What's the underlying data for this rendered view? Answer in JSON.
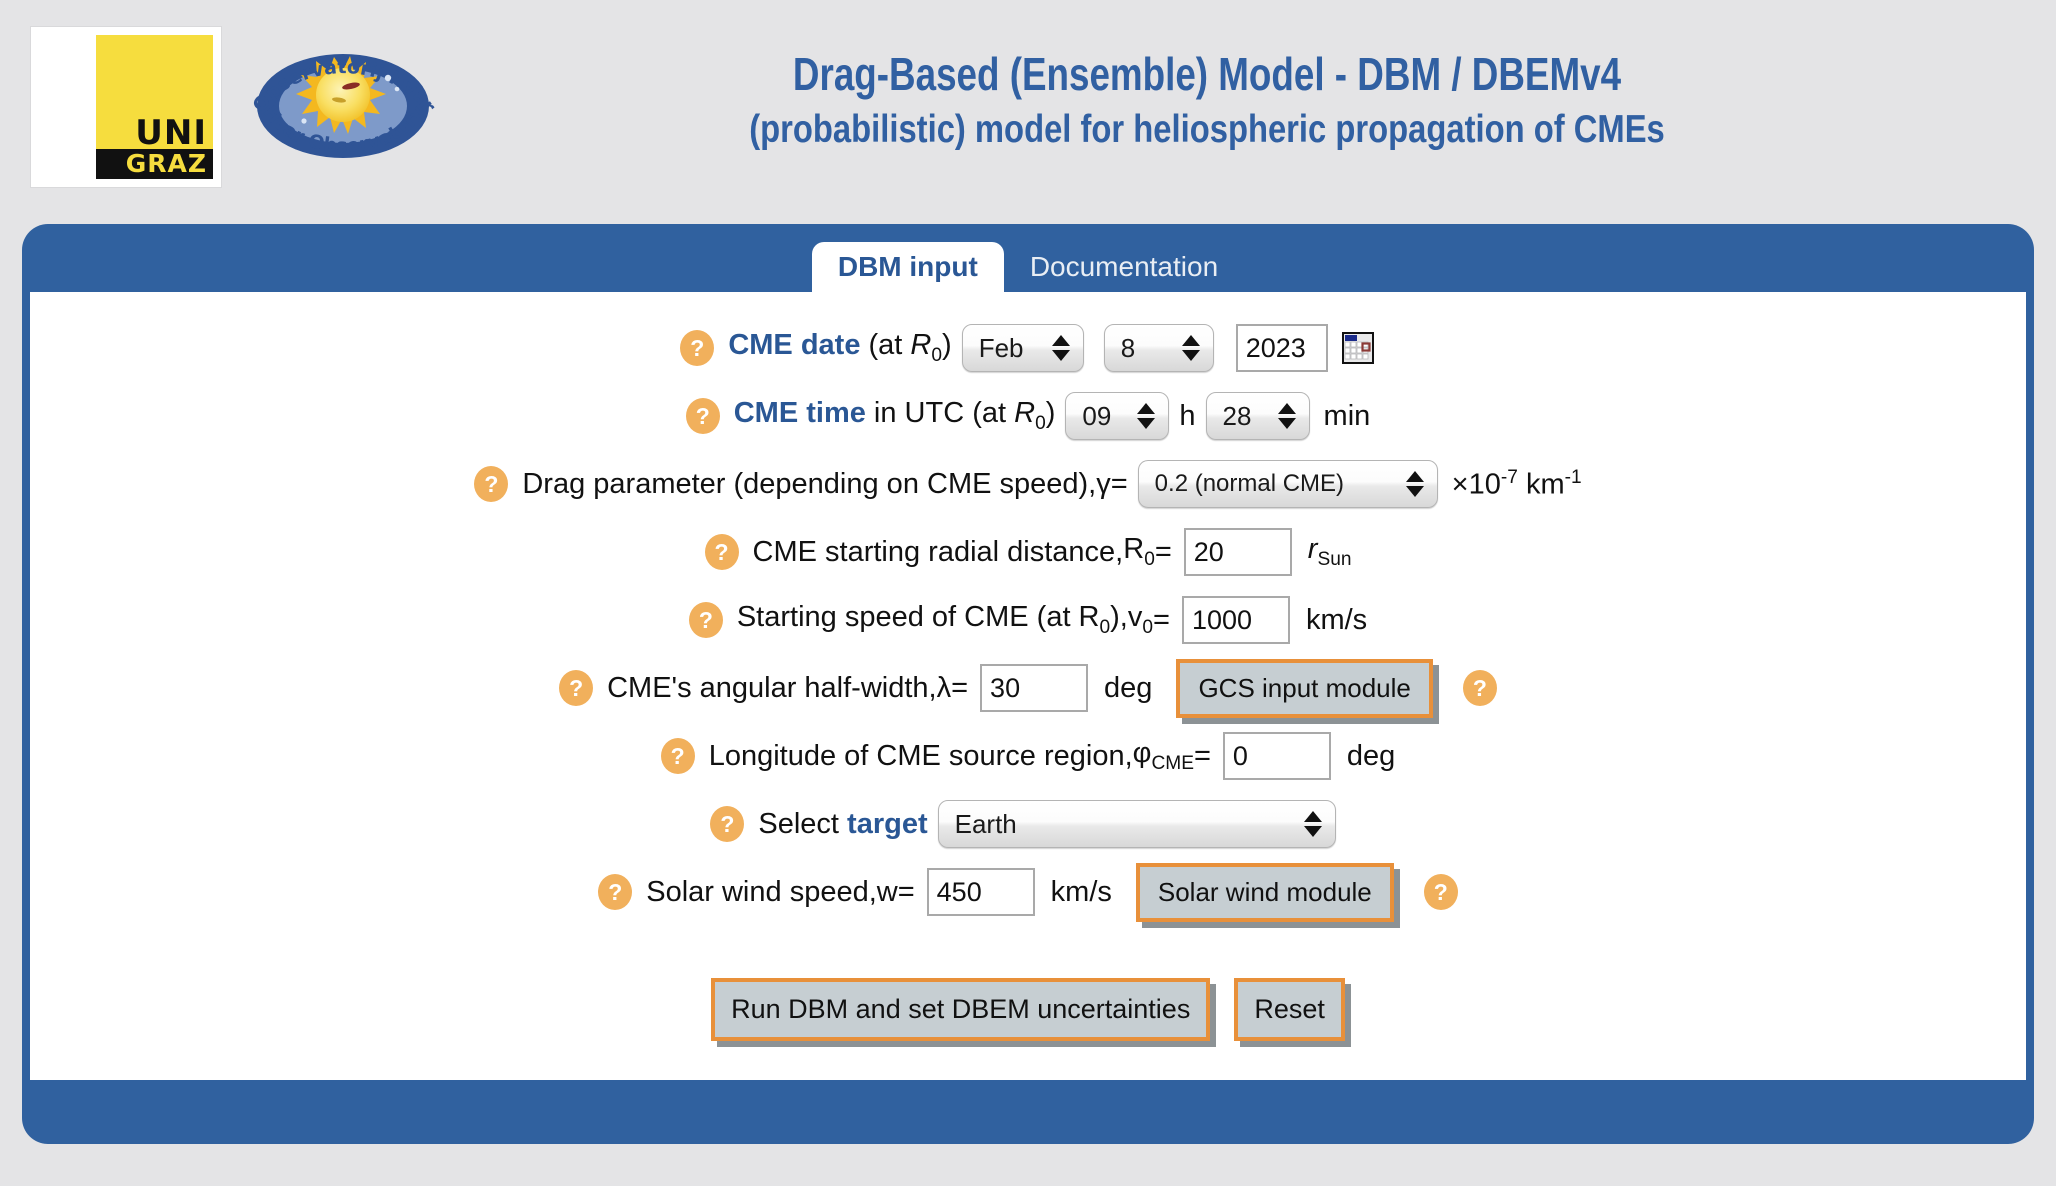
{
  "header": {
    "logo_unigraz": {
      "line1": "UNI",
      "line2": "GRAZ",
      "icon": "unigraz-logo"
    },
    "logo_hvar": {
      "top_text": "Opservatorij Hvar",
      "bottom_text": "Hvar Observatory",
      "icon": "hvar-observatory-logo"
    },
    "title_main": "Drag-Based (Ensemble) Model - DBM / DBEMv4",
    "title_sub": "(probabilistic) model for heliospheric propagation of CMEs"
  },
  "tabs": [
    {
      "label": "DBM input",
      "active": true
    },
    {
      "label": "Documentation",
      "active": false
    }
  ],
  "form": {
    "cme_date": {
      "help": "?",
      "label_bold": "CME date",
      "label_rest": " (at R",
      "label_sub": "0",
      "label_tail": ")",
      "month": "Feb",
      "day": "8",
      "year": "2023",
      "calendar_icon": "calendar-icon"
    },
    "cme_time": {
      "help": "?",
      "label_bold": "CME time",
      "label_rest": " in UTC (at R",
      "label_sub": "0",
      "label_tail": ")",
      "hour": "09",
      "hour_unit": "h",
      "minute": "28",
      "minute_unit": "min"
    },
    "drag_parameter": {
      "help": "?",
      "label": "Drag parameter (depending on CME speed), ",
      "symbol": "γ",
      "equals": " = ",
      "value": "0.2 (normal CME)",
      "unit_prefix": "×10",
      "unit_exp": "-7",
      "unit_km": " km",
      "unit_km_exp": "-1"
    },
    "r0": {
      "help": "?",
      "label": "CME starting radial distance, ",
      "symbol": "R",
      "symbol_sub": "0",
      "equals": " = ",
      "value": "20",
      "unit": "r",
      "unit_sub": "Sun"
    },
    "v0": {
      "help": "?",
      "label_a": "Starting speed of CME (at R",
      "label_a_sub": "0",
      "label_b": "), ",
      "symbol": "v",
      "symbol_sub": "0",
      "equals": " = ",
      "value": "1000",
      "unit": "km/s"
    },
    "lambda": {
      "help": "?",
      "label": "CME's angular half-width, ",
      "symbol": "λ",
      "equals": " = ",
      "value": "30",
      "unit": "deg",
      "module_button": "GCS input module",
      "module_help": "?"
    },
    "phi": {
      "help": "?",
      "label": "Longitude of CME source region, ",
      "symbol": "φ",
      "symbol_sub": "CME",
      "equals": " = ",
      "value": "0",
      "unit": "deg"
    },
    "target": {
      "help": "?",
      "label_a": "Select ",
      "label_bold": "target",
      "value": "Earth"
    },
    "solar_wind": {
      "help": "?",
      "label": "Solar wind speed, ",
      "symbol": "w",
      "equals": " = ",
      "value": "450",
      "unit": "km/s",
      "module_button": "Solar wind module",
      "module_help": "?"
    }
  },
  "actions": {
    "run_label": "Run DBM and set DBEM uncertainties",
    "reset_label": "Reset"
  },
  "colors": {
    "page_bg": "#e4e4e6",
    "panel_blue": "#30619f",
    "accent_blue": "#2a5795",
    "title_blue": "#3160a2",
    "help_orange": "#f1b05c",
    "button_orange": "#e8903a",
    "button_face": "#c6ced2",
    "unigraz_yellow": "#f6dd3e"
  }
}
